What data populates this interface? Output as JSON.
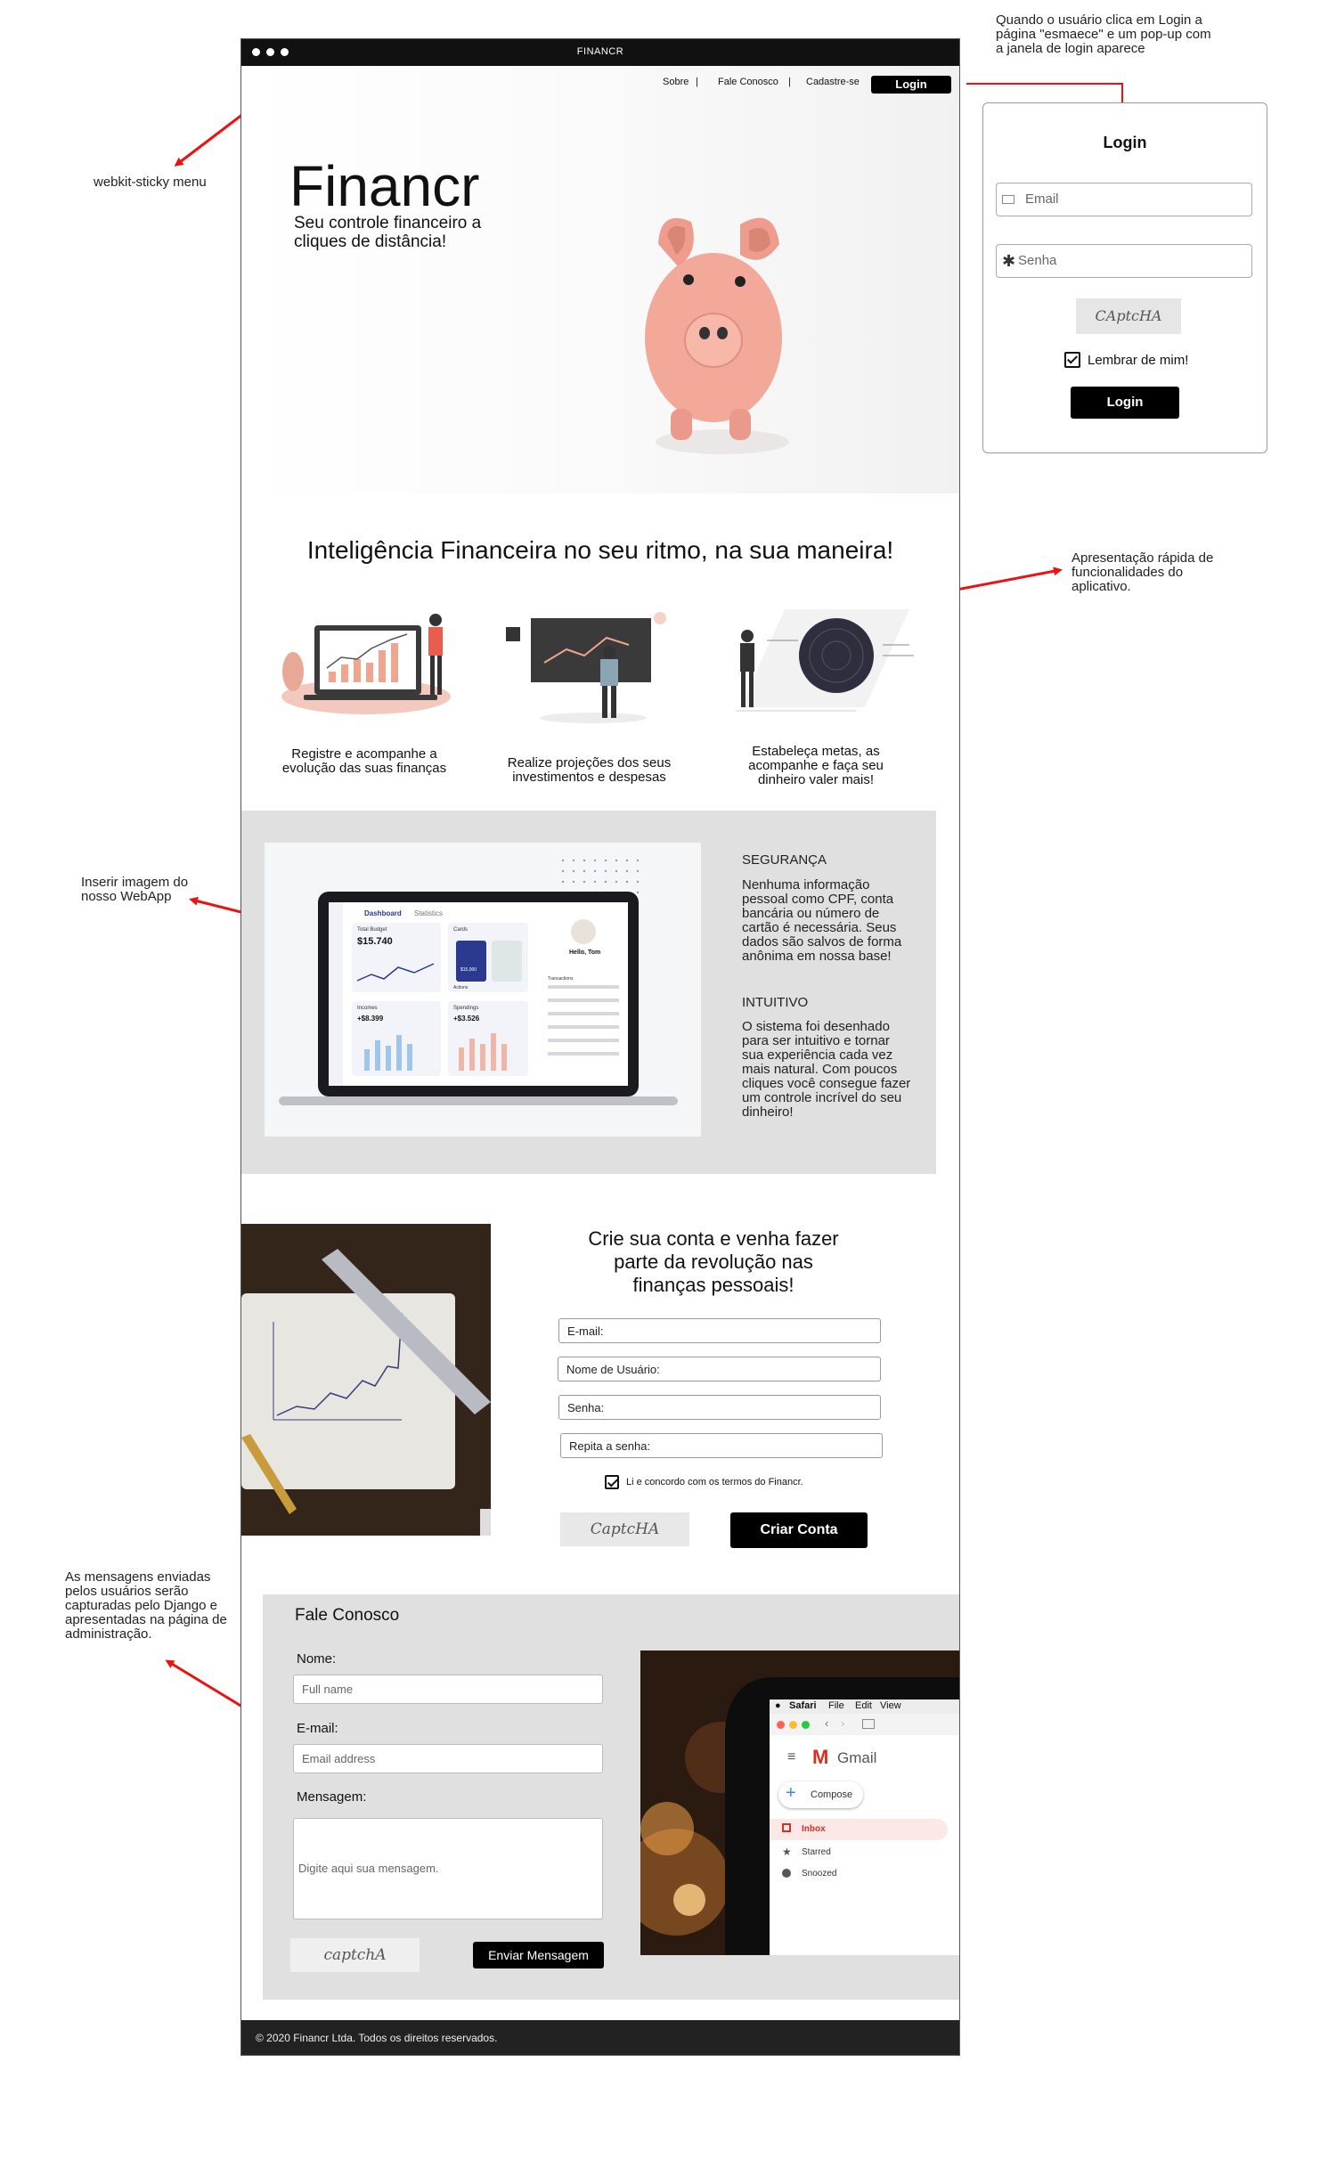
{
  "window": {
    "title": "FINANCR"
  },
  "nav": {
    "about": "Sobre",
    "contact": "Fale Conosco",
    "signup": "Cadastre-se",
    "login": "Login",
    "sep": "|"
  },
  "hero": {
    "brand": "Financr",
    "tagline": "Seu controle financeiro a cliques de distância!"
  },
  "features": {
    "title": "Inteligência Financeira no seu ritmo, na sua maneira!",
    "items": [
      {
        "label": "Registre e acompanhe a evolução das suas finanças"
      },
      {
        "label": "Realize projeções dos seus investimentos e despesas"
      },
      {
        "label": "Estabeleça metas, as acompanhe e faça seu dinheiro valer mais!"
      }
    ]
  },
  "info": {
    "security_title": "SEGURANÇA",
    "security_text": "Nenhuma informação pessoal como CPF, conta bancária ou número de cartão é necessária. Seus dados são salvos de forma anônima em nossa base!",
    "intuitive_title": "INTUITIVO",
    "intuitive_text": "O sistema foi desenhado para ser intuitivo e tornar sua experiência cada vez mais natural. Com poucos cliques você consegue fazer um controle incrível do seu dinheiro!"
  },
  "dashboard": {
    "tab_active": "Dashboard",
    "tab_other": "Statistics",
    "budget_label": "Total Budget",
    "budget_value": "$15.740",
    "cards_label": "Cards",
    "card_value": "$15,000",
    "incomes_label": "Incomes",
    "incomes_value": "+$8.399",
    "spendings_label": "Spendings",
    "spendings_value": "+$3.526",
    "user_greeting": "Hello, Tom",
    "transactions_label": "Transactions",
    "actions_label": "Actions"
  },
  "signup": {
    "title": "Crie sua conta e venha fazer parte da revolução nas finanças pessoais!",
    "email": "E-mail:",
    "username": "Nome de Usuário:",
    "password": "Senha:",
    "repeat": "Repita a senha:",
    "terms": "Li e concordo com os termos do Financr.",
    "captcha": "CaptcHA",
    "submit": "Criar Conta"
  },
  "contact": {
    "title": "Fale Conosco",
    "name_label": "Nome:",
    "name_placeholder": "Full name",
    "email_label": "E-mail:",
    "email_placeholder": "Email address",
    "message_label": "Mensagem:",
    "message_placeholder": "Digite aqui sua mensagem.",
    "captcha": "captchA",
    "submit": "Enviar Mensagem"
  },
  "gmail": {
    "browser": "Safari",
    "menu_file": "File",
    "menu_edit": "Edit",
    "menu_view": "View",
    "app": "Gmail",
    "compose": "Compose",
    "inbox": "Inbox",
    "starred": "Starred",
    "snoozed": "Snoozed"
  },
  "footer": {
    "text": "© 2020 Financr Ltda. Todos os direitos reservados."
  },
  "login_popup": {
    "title": "Login",
    "email_placeholder": "Email",
    "password_placeholder": "Senha",
    "captcha": "CAptcHA",
    "remember": "Lembrar de mim!",
    "submit": "Login"
  },
  "annotations": {
    "sticky": "webkit-sticky menu",
    "login_popup": "Quando o usuário clica em Login a página \"esmaece\" e um pop-up com a janela de login aparece",
    "presentation": "Apresentação rápida de funcionalidades do aplicativo.",
    "webapp": "Inserir imagem do nosso WebApp",
    "messages": "As mensagens enviadas pelos usuários serão capturadas pelo Django e apresentadas na página de administração."
  },
  "colors": {
    "annotation_arrow": "#ee1111",
    "gray_section": "#e0e0e0",
    "primary_button": "#000000",
    "piggy": "#f2a99a"
  }
}
